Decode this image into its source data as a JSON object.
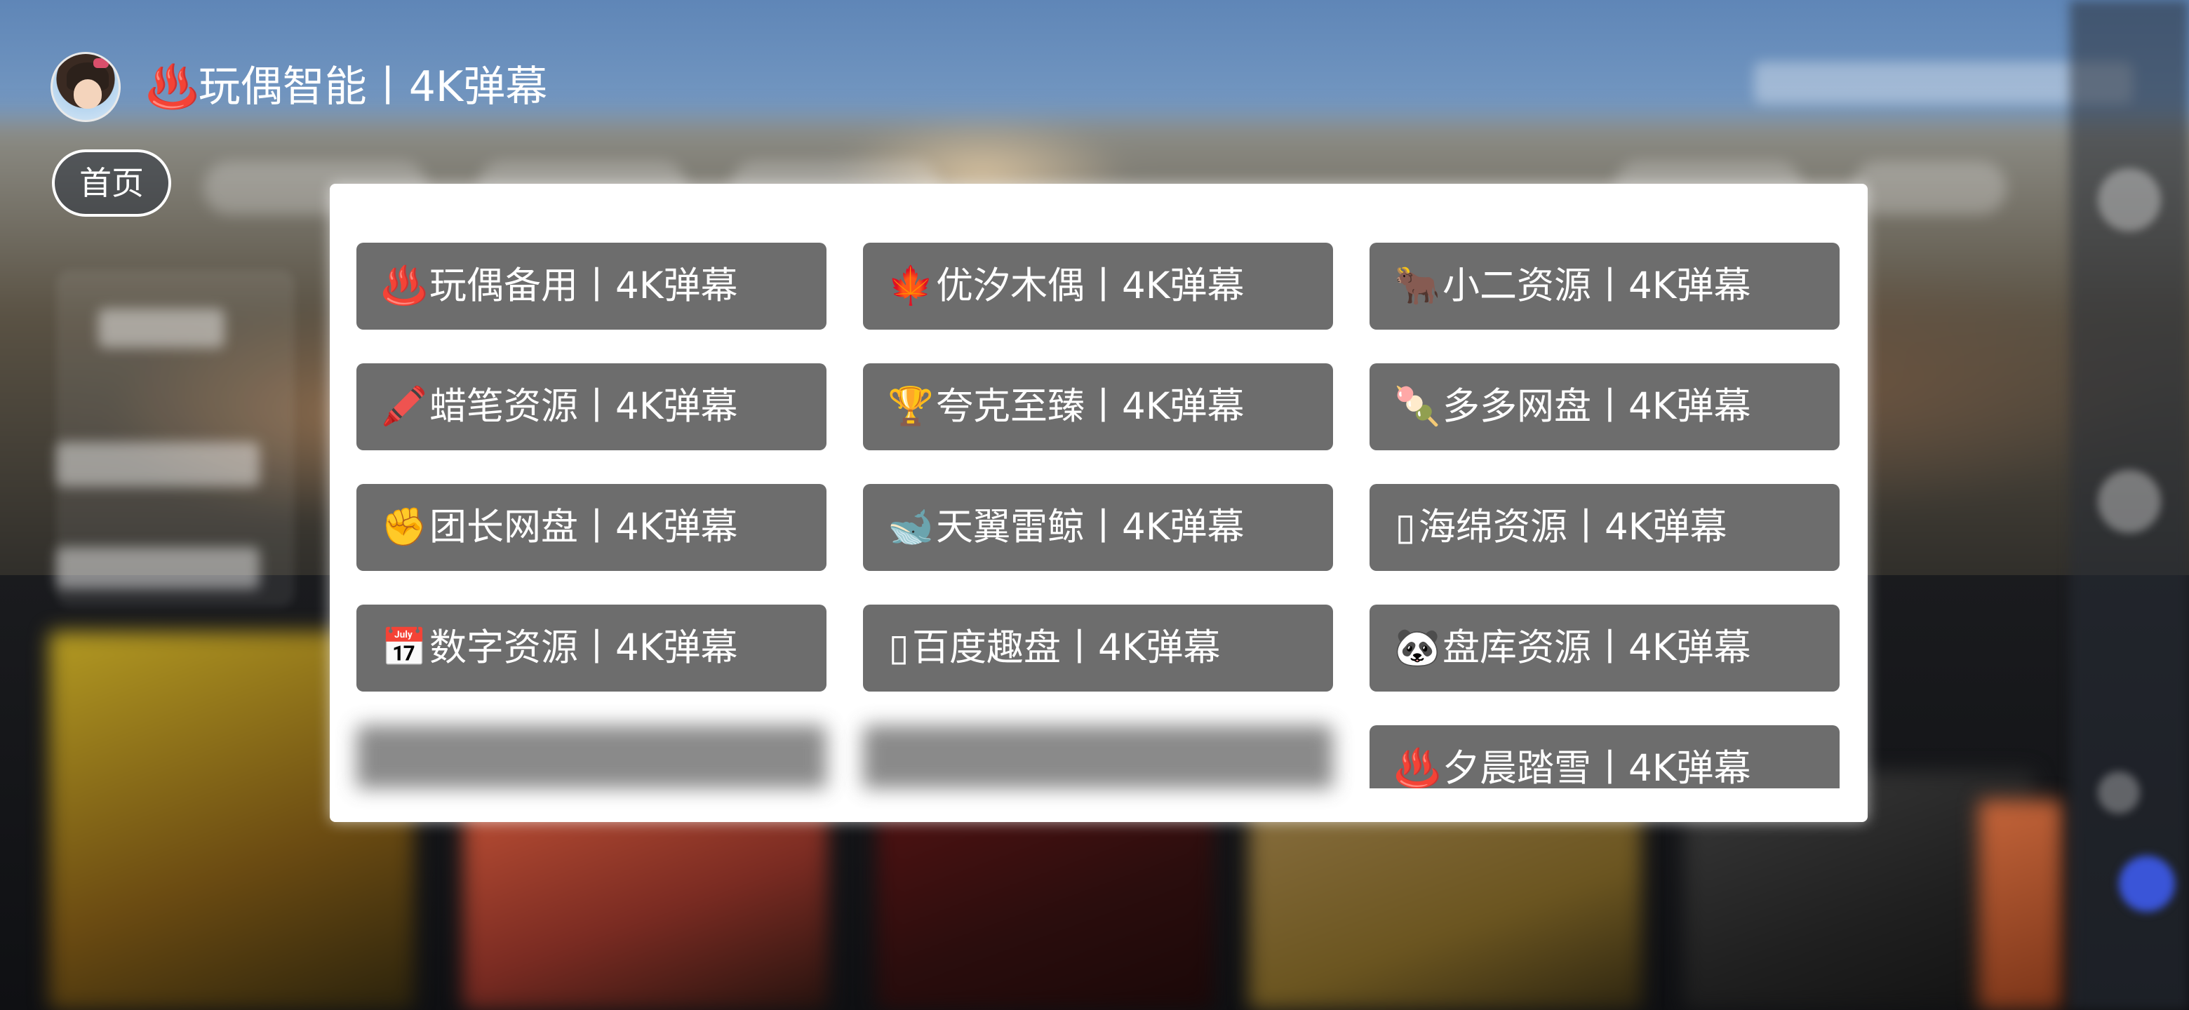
{
  "header": {
    "app_title": "♨️玩偶智能丨4K弹幕",
    "home_tab": "首页"
  },
  "sources": [
    {
      "icon": "♨️",
      "label": "玩偶备用丨4K弹幕",
      "icon_name": "hot-springs-icon"
    },
    {
      "icon": "🍁",
      "label": "优汐木偶丨4K弹幕",
      "icon_name": "maple-leaf-icon"
    },
    {
      "icon": "🐂",
      "label": "小二资源丨4K弹幕",
      "icon_name": "ox-icon"
    },
    {
      "icon": "🖍️",
      "label": "蜡笔资源丨4K弹幕",
      "icon_name": "crayon-icon"
    },
    {
      "icon": "🏆",
      "label": "夸克至臻丨4K弹幕",
      "icon_name": "trophy-icon"
    },
    {
      "icon": "🍡",
      "label": "多多网盘丨4K弹幕",
      "icon_name": "dango-icon"
    },
    {
      "icon": "✊",
      "label": "团长网盘丨4K弹幕",
      "icon_name": "fist-icon"
    },
    {
      "icon": "🐋",
      "label": "天翼雷鲸丨4K弹幕",
      "icon_name": "whale-icon"
    },
    {
      "icon": "▯",
      "label": "海绵资源丨4K弹幕",
      "icon_name": "missing-glyph-icon"
    },
    {
      "icon": "📅",
      "label": "数字资源丨4K弹幕",
      "icon_name": "calendar-icon"
    },
    {
      "icon": "▯",
      "label": "百度趣盘丨4K弹幕",
      "icon_name": "missing-glyph-icon"
    },
    {
      "icon": "🐼",
      "label": "盘库资源丨4K弹幕",
      "icon_name": "panda-icon"
    },
    {
      "icon": "",
      "label": "",
      "icon_name": "blurred-icon"
    },
    {
      "icon": "",
      "label": "",
      "icon_name": "blurred-icon"
    },
    {
      "icon": "♨️",
      "label": "夕晨踏雪丨4K弹幕",
      "icon_name": "hot-springs-icon"
    }
  ],
  "colors": {
    "button_bg": "#6d6d6d",
    "popup_bg": "#ffffff",
    "text": "#ffffff"
  }
}
